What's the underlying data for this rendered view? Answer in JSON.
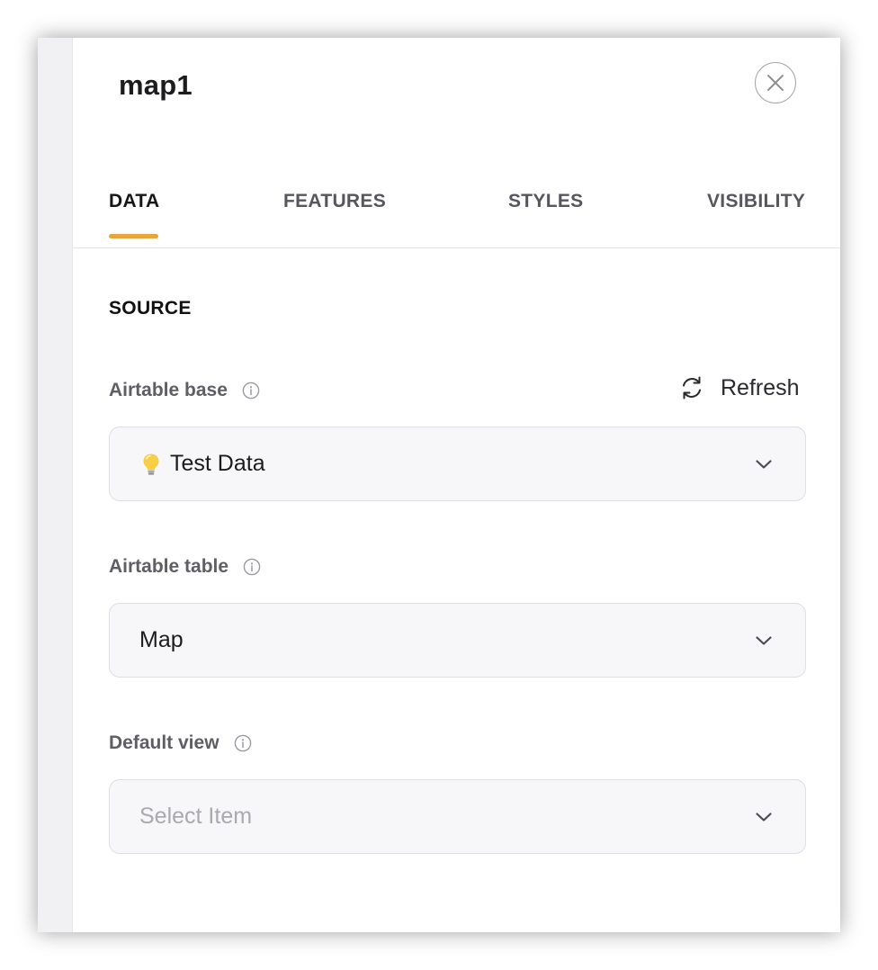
{
  "panel": {
    "title": "map1",
    "close_icon": "close-icon"
  },
  "tabs": [
    {
      "label": "DATA",
      "active": true
    },
    {
      "label": "FEATURES",
      "active": false
    },
    {
      "label": "STYLES",
      "active": false
    },
    {
      "label": "VISIBILITY",
      "active": false
    }
  ],
  "colors": {
    "accent": "#e8a53c",
    "label": "#5e5e64",
    "field_bg": "#f7f7f9",
    "placeholder": "#a9a9ae"
  },
  "source": {
    "section_title": "SOURCE",
    "refresh_label": "Refresh",
    "refresh_icon": "refresh-icon",
    "base": {
      "label": "Airtable base",
      "info_icon": "info-icon",
      "value_emoji": "lightbulb-icon",
      "value": "Test Data"
    },
    "table": {
      "label": "Airtable table",
      "info_icon": "info-icon",
      "value": "Map"
    },
    "view": {
      "label": "Default view",
      "info_icon": "info-icon",
      "placeholder": "Select Item"
    }
  }
}
